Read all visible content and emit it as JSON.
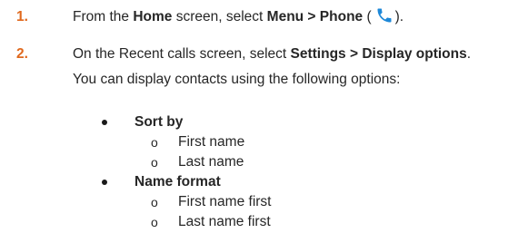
{
  "steps": [
    {
      "number": "1.",
      "parts": {
        "t1": "From the ",
        "b1": "Home",
        "t2": " screen, select ",
        "b2": "Menu > Phone",
        "t3": " (",
        "t4": ")."
      },
      "icon": "phone-icon"
    },
    {
      "number": "2.",
      "parts": {
        "t1": "On the Recent calls screen, select ",
        "b1": "Settings > Display options",
        "t2": "."
      },
      "continuation": "You can display contacts using the following options:"
    }
  ],
  "options": [
    {
      "label": "Sort by",
      "items": [
        "First name",
        "Last name"
      ]
    },
    {
      "label": "Name format",
      "items": [
        "First name first",
        "Last name first"
      ]
    }
  ],
  "sub_marker": "o",
  "colors": {
    "step_number": "#e0691e",
    "phone_icon": "#1e88d8",
    "text": "#262626"
  }
}
